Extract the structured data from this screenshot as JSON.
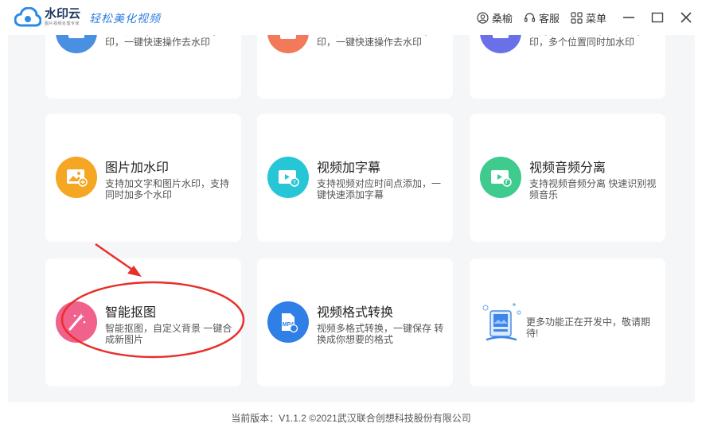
{
  "app": {
    "name": "水印云",
    "subtitle": "图片视频处理专家",
    "slogan": "轻松美化视频"
  },
  "titlebar": {
    "user_label": "桑榆",
    "service_label": "客服",
    "menu_label": "菜单"
  },
  "cards_partial": [
    {
      "desc": "框选视频水印区，批量去水印，一键快速操作去水印",
      "icon": "video-watermark-remove-icon",
      "color": "#4a90e2"
    },
    {
      "desc": "框选图片水印区，批量去水印，一键快速操作去水印",
      "icon": "image-watermark-remove-icon",
      "color": "#f27a5a"
    },
    {
      "desc": "支持视频中加文字和图片水印，多个位置同时加水印",
      "icon": "video-watermark-add-icon",
      "color": "#6a70e8"
    }
  ],
  "cards": [
    {
      "title": "图片加水印",
      "desc": "支持加文字和图片水印，支持同时加多个水印",
      "icon": "image-add-icon",
      "color": "#f5a623"
    },
    {
      "title": "视频加字幕",
      "desc": "支持视频对应时间点添加，一键快速添加字幕",
      "icon": "video-subtitle-icon",
      "color": "#27c6d6"
    },
    {
      "title": "视频音频分离",
      "desc": "支持视频音频分离 快速识别视频音乐",
      "icon": "audio-separate-icon",
      "color": "#3fca8e"
    },
    {
      "title": "智能抠图",
      "desc": "智能抠图，自定义背景 一键合成新图片",
      "icon": "magic-wand-icon",
      "color": "#f0618c"
    },
    {
      "title": "视频格式转换",
      "desc": "视频多格式转换，一键保存 转换成你想要的格式",
      "icon": "mp4-file-icon",
      "color": "#2f7fe6"
    }
  ],
  "coming_soon": {
    "desc": "更多功能正在开发中，敬请期待!"
  },
  "icons": {
    "mp4_text": "MP4"
  },
  "footer": {
    "version": "当前版本：V1.1.2 ©2021武汉联合创想科技股份有限公司"
  },
  "colors": {
    "annotation_red": "#e8302a",
    "background": "#f5f6f8",
    "card": "#ffffff"
  }
}
